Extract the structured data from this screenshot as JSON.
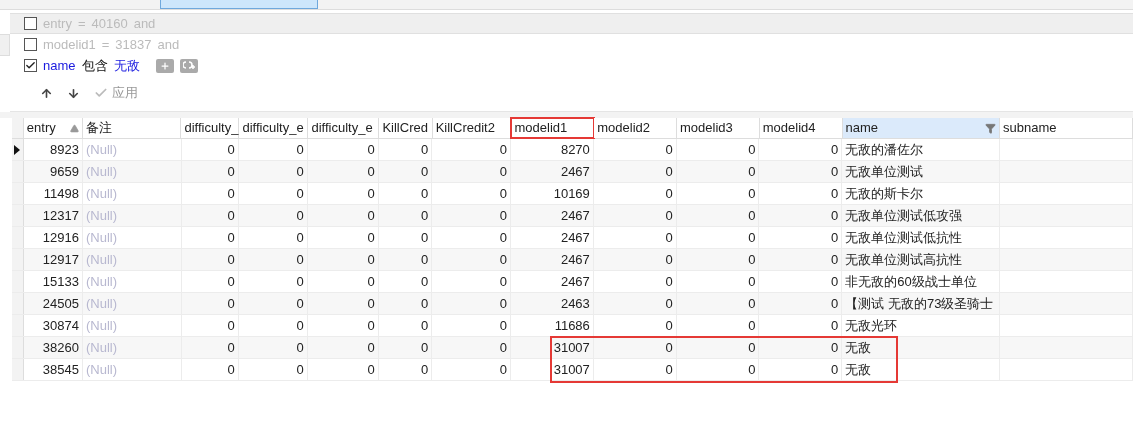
{
  "filter": {
    "conditions": [
      {
        "checked": false,
        "field": "entry",
        "operator": "=",
        "value": "40160",
        "conjunction": "and",
        "hovered": true
      },
      {
        "checked": false,
        "field": "modelid1",
        "operator": "=",
        "value": "31837",
        "conjunction": "and",
        "hovered": false
      },
      {
        "checked": true,
        "field": "name",
        "operator": "包含",
        "value": "无敌",
        "hovered": false
      }
    ],
    "actions": {
      "apply": "应用"
    }
  },
  "table": {
    "columns": [
      {
        "label": "entry",
        "numeric": true,
        "sorted": true,
        "filtered": false,
        "highlighted": false
      },
      {
        "label": "备注",
        "numeric": false,
        "sorted": false,
        "filtered": false,
        "highlighted": false
      },
      {
        "label": "difficulty_",
        "numeric": true,
        "sorted": false,
        "filtered": false,
        "highlighted": false
      },
      {
        "label": "difficulty_e",
        "numeric": true,
        "sorted": false,
        "filtered": false,
        "highlighted": false
      },
      {
        "label": "difficulty_e",
        "numeric": true,
        "sorted": false,
        "filtered": false,
        "highlighted": false
      },
      {
        "label": "KillCred",
        "numeric": true,
        "sorted": false,
        "filtered": false,
        "highlighted": false
      },
      {
        "label": "KillCredit2",
        "numeric": true,
        "sorted": false,
        "filtered": false,
        "highlighted": false
      },
      {
        "label": "modelid1",
        "numeric": true,
        "sorted": false,
        "filtered": false,
        "highlighted": true
      },
      {
        "label": "modelid2",
        "numeric": true,
        "sorted": false,
        "filtered": false,
        "highlighted": false
      },
      {
        "label": "modelid3",
        "numeric": true,
        "sorted": false,
        "filtered": false,
        "highlighted": false
      },
      {
        "label": "modelid4",
        "numeric": true,
        "sorted": false,
        "filtered": false,
        "highlighted": false
      },
      {
        "label": "name",
        "numeric": false,
        "sorted": false,
        "filtered": true,
        "highlighted": false
      },
      {
        "label": "subname",
        "sorted": false,
        "filtered": false,
        "highlighted": false
      }
    ],
    "rows": [
      {
        "selected": true,
        "highlighted": false,
        "cells": [
          "8923",
          "(Null)",
          "0",
          "0",
          "0",
          "0",
          "0",
          "8270",
          "0",
          "0",
          "0",
          "无敌的潘佐尔",
          ""
        ]
      },
      {
        "selected": false,
        "highlighted": false,
        "cells": [
          "9659",
          "(Null)",
          "0",
          "0",
          "0",
          "0",
          "0",
          "2467",
          "0",
          "0",
          "0",
          "无敌单位测试",
          ""
        ]
      },
      {
        "selected": false,
        "highlighted": false,
        "cells": [
          "11498",
          "(Null)",
          "0",
          "0",
          "0",
          "0",
          "0",
          "10169",
          "0",
          "0",
          "0",
          "无敌的斯卡尔",
          ""
        ]
      },
      {
        "selected": false,
        "highlighted": false,
        "cells": [
          "12317",
          "(Null)",
          "0",
          "0",
          "0",
          "0",
          "0",
          "2467",
          "0",
          "0",
          "0",
          "无敌单位测试低攻强",
          ""
        ]
      },
      {
        "selected": false,
        "highlighted": false,
        "cells": [
          "12916",
          "(Null)",
          "0",
          "0",
          "0",
          "0",
          "0",
          "2467",
          "0",
          "0",
          "0",
          "无敌单位测试低抗性",
          ""
        ]
      },
      {
        "selected": false,
        "highlighted": false,
        "cells": [
          "12917",
          "(Null)",
          "0",
          "0",
          "0",
          "0",
          "0",
          "2467",
          "0",
          "0",
          "0",
          "无敌单位测试高抗性",
          ""
        ]
      },
      {
        "selected": false,
        "highlighted": false,
        "cells": [
          "15133",
          "(Null)",
          "0",
          "0",
          "0",
          "0",
          "0",
          "2467",
          "0",
          "0",
          "0",
          "非无敌的60级战士单位",
          ""
        ]
      },
      {
        "selected": false,
        "highlighted": false,
        "cells": [
          "24505",
          "(Null)",
          "0",
          "0",
          "0",
          "0",
          "0",
          "2463",
          "0",
          "0",
          "0",
          "【测试 无敌的73级圣骑士",
          ""
        ]
      },
      {
        "selected": false,
        "highlighted": false,
        "cells": [
          "30874",
          "(Null)",
          "0",
          "0",
          "0",
          "0",
          "0",
          "11686",
          "0",
          "0",
          "0",
          "无敌光环",
          ""
        ]
      },
      {
        "selected": false,
        "highlighted": true,
        "cells": [
          "38260",
          "(Null)",
          "0",
          "0",
          "0",
          "0",
          "0",
          "31007",
          "0",
          "0",
          "0",
          "无敌",
          ""
        ]
      },
      {
        "selected": false,
        "highlighted": true,
        "cells": [
          "38545",
          "(Null)",
          "0",
          "0",
          "0",
          "0",
          "0",
          "31007",
          "0",
          "0",
          "0",
          "无敌",
          ""
        ]
      }
    ]
  }
}
